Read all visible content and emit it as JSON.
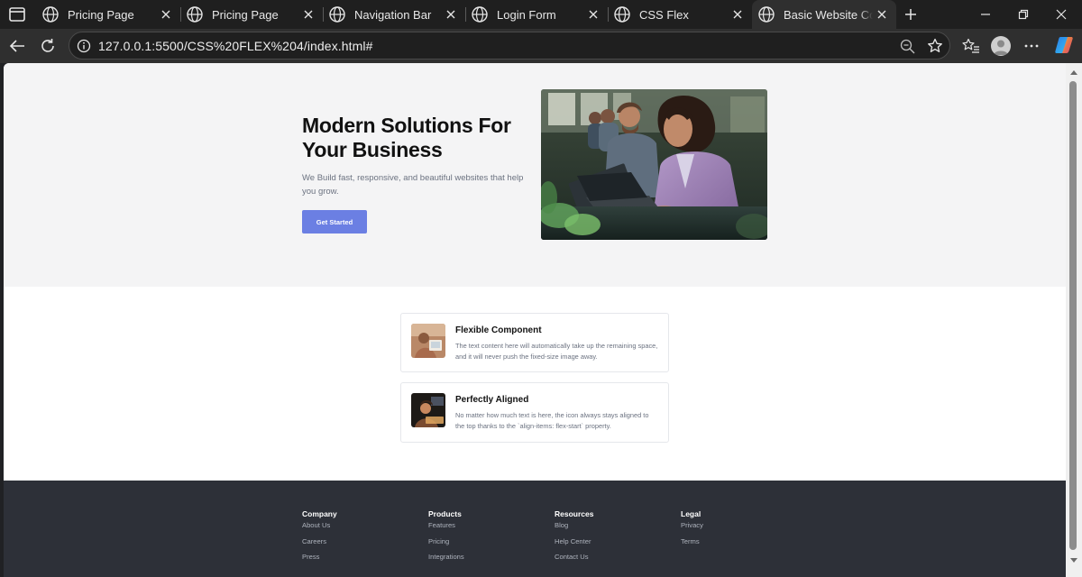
{
  "browser": {
    "tabs": [
      {
        "title": "Pricing Page"
      },
      {
        "title": "Pricing Page"
      },
      {
        "title": "Navigation Bar"
      },
      {
        "title": "Login Form"
      },
      {
        "title": "CSS Flex"
      },
      {
        "title": "Basic Website Comp"
      }
    ],
    "url": "127.0.0.1:5500/CSS%20FLEX%204/index.html#"
  },
  "hero": {
    "title": "Modern Solutions For Your Business",
    "subtitle": "We Build fast, responsive, and beautiful websites that help you grow.",
    "cta_label": "Get Started"
  },
  "cards": [
    {
      "title": "Flexible Component",
      "text": "The text content here will automatically take up the remaining space, and it will never push the fixed-size image away."
    },
    {
      "title": "Perfectly Aligned",
      "text": "No matter how much text is here, the icon always stays aligned to the top thanks to the `align-items: flex-start` property."
    }
  ],
  "footer": {
    "columns": [
      {
        "heading": "Company",
        "links": [
          "About Us",
          "Careers",
          "Press"
        ]
      },
      {
        "heading": "Products",
        "links": [
          "Features",
          "Pricing",
          "Integrations"
        ]
      },
      {
        "heading": "Resources",
        "links": [
          "Blog",
          "Help Center",
          "Contact Us"
        ]
      },
      {
        "heading": "Legal",
        "links": [
          "Privacy",
          "Terms"
        ]
      }
    ]
  },
  "colors": {
    "accent": "#6b7fe3",
    "footer_bg": "#2d3038",
    "hero_bg": "#f4f4f5"
  }
}
